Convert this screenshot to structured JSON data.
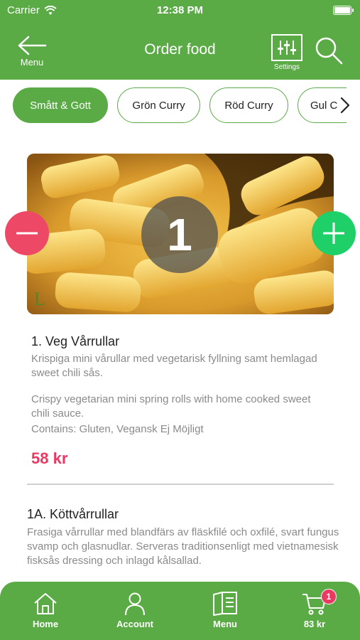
{
  "status_bar": {
    "carrier": "Carrier",
    "time": "12:38 PM"
  },
  "header": {
    "back_label": "Menu",
    "title": "Order food",
    "settings_label": "Settings"
  },
  "categories": [
    {
      "label": "Smått & Gott",
      "active": true
    },
    {
      "label": "Grön Curry",
      "active": false
    },
    {
      "label": "Röd Curry",
      "active": false
    },
    {
      "label": "Gul C",
      "active": false
    }
  ],
  "product": {
    "quantity": "1",
    "image_mark": "L",
    "name": "1. Veg Vårrullar",
    "desc_sv": "Krispiga mini vårullar med vegetarisk fyllning samt hemlagad sweet chili sås.",
    "desc_en": "Crispy vegetarian mini spring rolls with home cooked sweet chili sauce.",
    "contains": "Contains: Gluten, Vegansk Ej Möjligt",
    "price": "58 kr"
  },
  "product2": {
    "name": "1A. Köttvårrullar",
    "desc_sv": "Frasiga vårrullar med blandfärs av fläskfilé och oxfilé, svart fungus svamp och glasnudlar. Serveras traditionsenligt med vietnamesisk fisksås dressing och inlagd kålsallad."
  },
  "bottom_nav": {
    "home": "Home",
    "account": "Account",
    "menu": "Menu",
    "cart": "83 kr",
    "cart_badge": "1"
  },
  "colors": {
    "brand": "#5aab45",
    "price": "#e83a63",
    "minus": "#ee4867",
    "plus": "#1fd068"
  }
}
